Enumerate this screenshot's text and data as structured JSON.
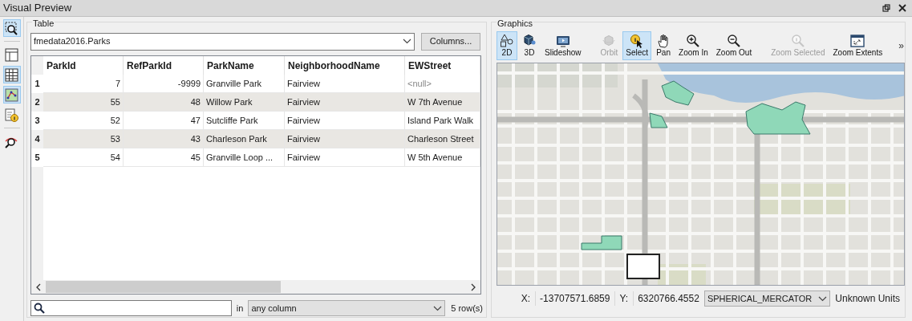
{
  "window": {
    "title": "Visual Preview"
  },
  "left_tools": [
    {
      "selected": true
    },
    {
      "selected": false
    },
    {
      "selected": true
    },
    {
      "selected": true
    },
    {
      "selected": false
    },
    {
      "selected": false
    }
  ],
  "table_panel": {
    "title": "Table",
    "dataset": "fmedata2016.Parks",
    "columns_button": "Columns...",
    "columns": [
      {
        "label": "ParkId",
        "kind": "number"
      },
      {
        "label": "RefParkId",
        "kind": "number"
      },
      {
        "label": "ParkName",
        "kind": "text"
      },
      {
        "label": "NeighborhoodName",
        "kind": "text"
      },
      {
        "label": "EWStreet",
        "kind": "text"
      }
    ],
    "rows": [
      {
        "number": "1",
        "cells": [
          "7",
          "-9999",
          "Granville Park",
          "Fairview",
          {
            "text": "<null>",
            "null": true
          }
        ]
      },
      {
        "number": "2",
        "cells": [
          "55",
          "48",
          "Willow Park",
          "Fairview",
          "W 7th Avenue"
        ]
      },
      {
        "number": "3",
        "cells": [
          "52",
          "47",
          "Sutcliffe Park",
          "Fairview",
          "Island Park Walk"
        ]
      },
      {
        "number": "4",
        "cells": [
          "53",
          "43",
          "Charleson Park",
          "Fairview",
          "Charleson Street"
        ]
      },
      {
        "number": "5",
        "cells": [
          "54",
          "45",
          "Granville Loop ...",
          "Fairview",
          "W 5th Avenue"
        ]
      }
    ],
    "search": {
      "in_label": "in",
      "column_choice": "any column",
      "row_count": "5 row(s)"
    }
  },
  "graphics_panel": {
    "title": "Graphics",
    "tool_groups": [
      [
        {
          "label": "2D",
          "selected": true,
          "disabled": false
        },
        {
          "label": "3D",
          "selected": false,
          "disabled": false
        },
        {
          "label": "Slideshow",
          "selected": false,
          "disabled": false
        }
      ],
      [
        {
          "label": "Orbit",
          "selected": false,
          "disabled": true
        },
        {
          "label": "Select",
          "selected": true,
          "disabled": false
        },
        {
          "label": "Pan",
          "selected": false,
          "disabled": false
        },
        {
          "label": "Zoom In",
          "selected": false,
          "disabled": false
        },
        {
          "label": "Zoom Out",
          "selected": false,
          "disabled": false
        }
      ],
      [
        {
          "label": "Zoom Selected",
          "selected": false,
          "disabled": true
        },
        {
          "label": "Zoom Extents",
          "selected": false,
          "disabled": false
        }
      ]
    ],
    "overflow": "»",
    "status": {
      "x_label": "X:",
      "x_value": "-13707571.6859",
      "y_label": "Y:",
      "y_value": "6320766.4552",
      "projection": "SPHERICAL_MERCATOR",
      "units": "Unknown Units"
    }
  }
}
